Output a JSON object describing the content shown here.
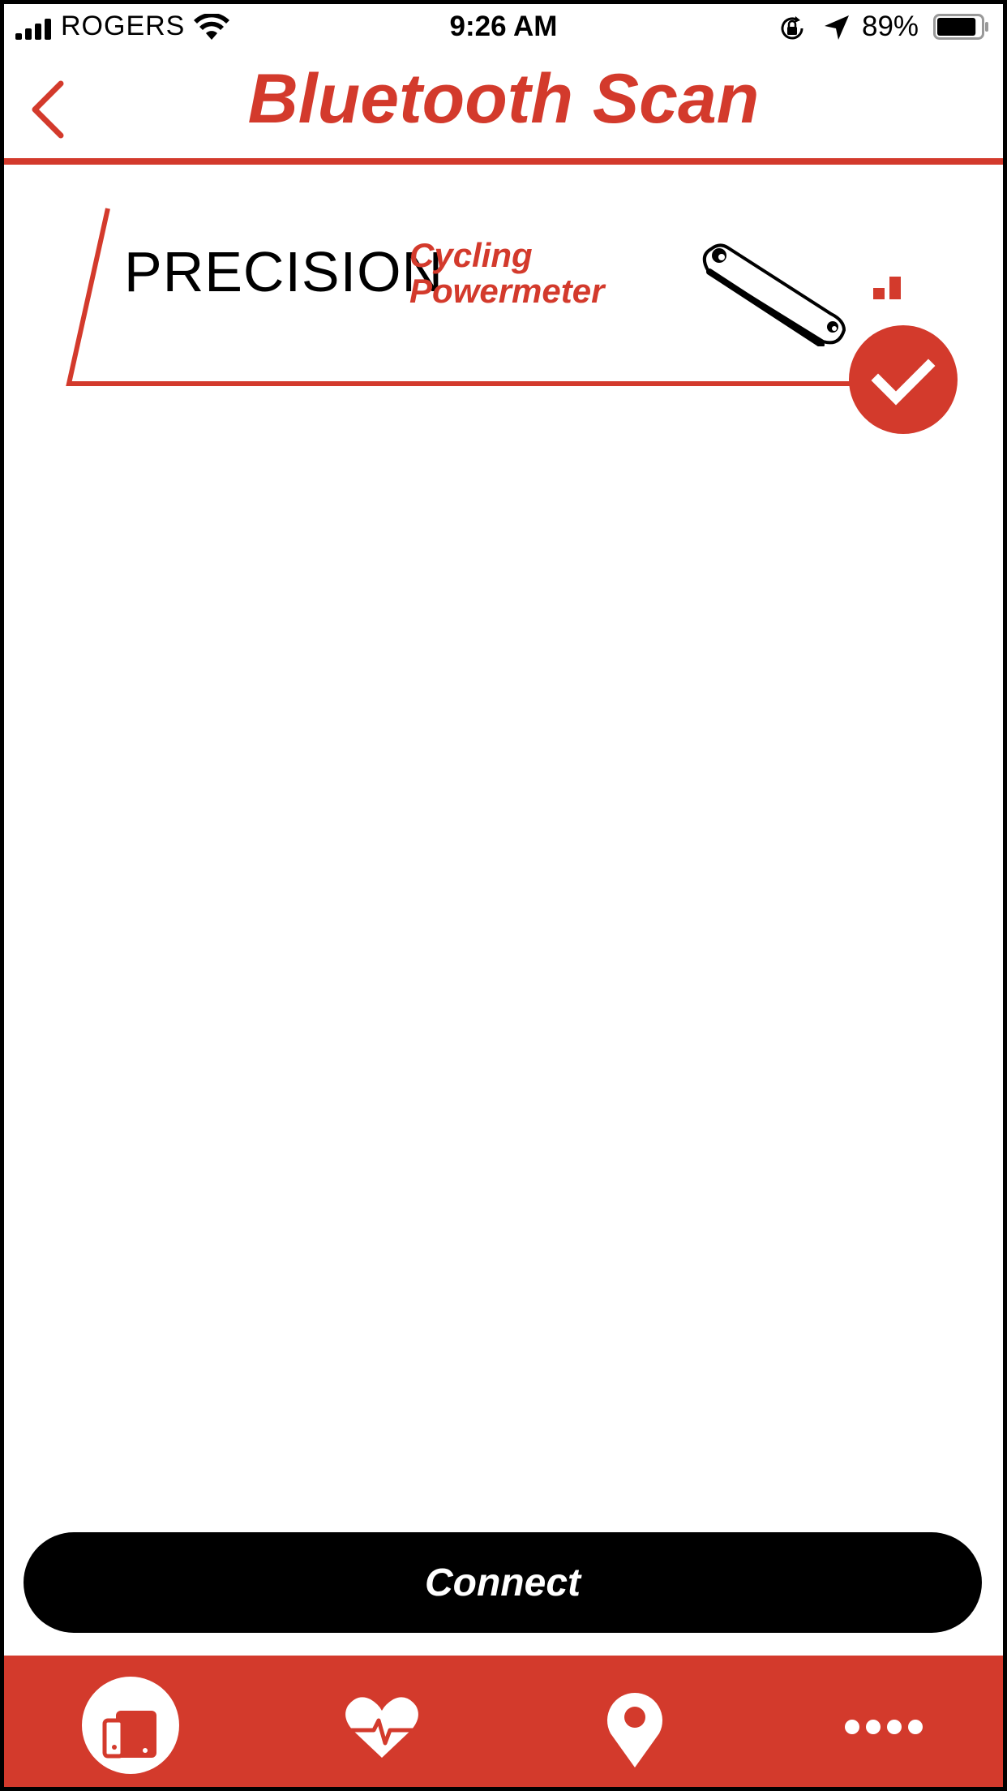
{
  "status_bar": {
    "carrier": "ROGERS",
    "time": "9:26 AM",
    "battery": "89%",
    "battery_level": 0.89
  },
  "header": {
    "title": "Bluetooth Scan",
    "back_icon": "chevron-left-icon"
  },
  "device": {
    "brand": "PRECISION",
    "subtitle_line1": "Cycling",
    "subtitle_line2": "Powermeter",
    "icon": "crank-arm-icon",
    "selected": true
  },
  "connect_label": "Connect",
  "tabs": [
    {
      "icon": "devices-icon",
      "active": true
    },
    {
      "icon": "heart-rate-icon",
      "active": false
    },
    {
      "icon": "location-pin-icon",
      "active": false
    },
    {
      "icon": "more-dots-icon",
      "active": false
    }
  ],
  "colors": {
    "accent": "#d33a2c",
    "text": "#000000",
    "background": "#ffffff"
  }
}
